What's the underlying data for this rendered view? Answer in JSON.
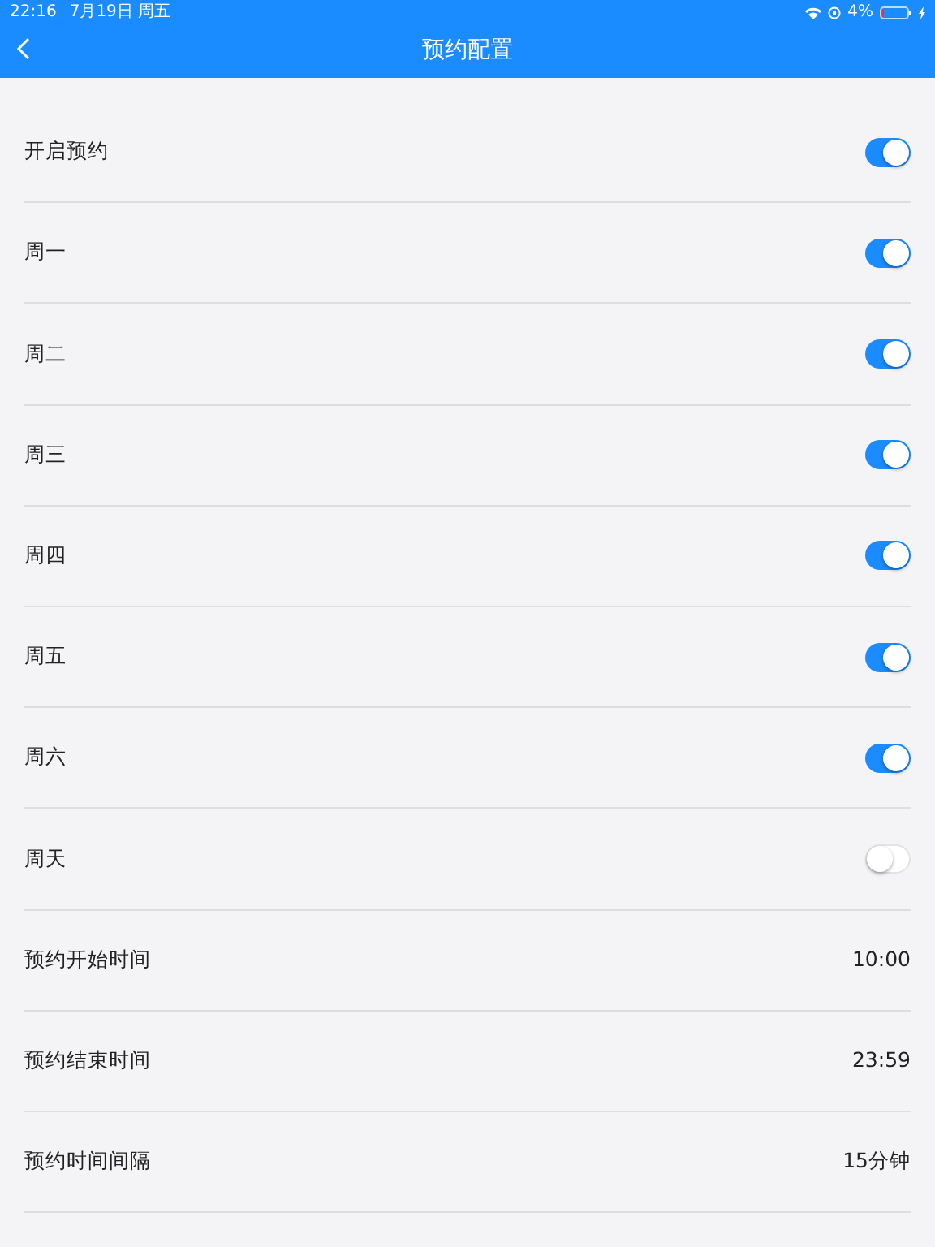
{
  "status_bar": {
    "time": "22:16",
    "date": "7月19日 周五",
    "battery": "4%"
  },
  "nav": {
    "title": "预约配置"
  },
  "rows": [
    {
      "kind": "toggle",
      "label": "开启预约",
      "on": true
    },
    {
      "kind": "toggle",
      "label": "周一",
      "on": true
    },
    {
      "kind": "toggle",
      "label": "周二",
      "on": true
    },
    {
      "kind": "toggle",
      "label": "周三",
      "on": true
    },
    {
      "kind": "toggle",
      "label": "周四",
      "on": true
    },
    {
      "kind": "toggle",
      "label": "周五",
      "on": true
    },
    {
      "kind": "toggle",
      "label": "周六",
      "on": true
    },
    {
      "kind": "toggle",
      "label": "周天",
      "on": false
    },
    {
      "kind": "value",
      "label": "预约开始时间",
      "value": "10:00"
    },
    {
      "kind": "value",
      "label": "预约结束时间",
      "value": "23:59"
    },
    {
      "kind": "value",
      "label": "预约时间间隔",
      "value": "15分钟"
    }
  ]
}
